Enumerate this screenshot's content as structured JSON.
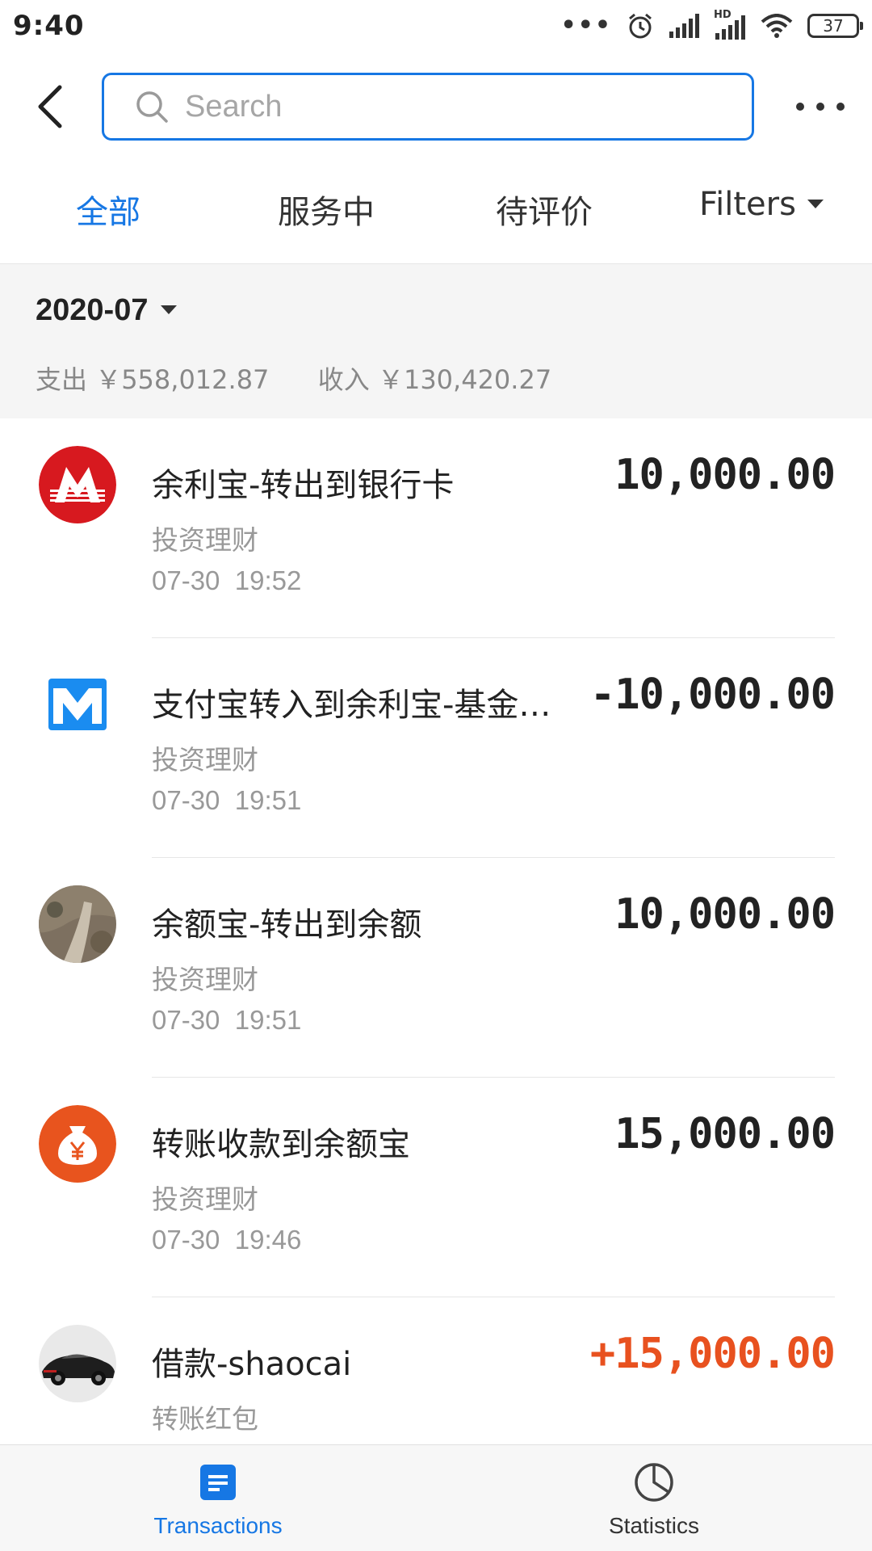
{
  "status_bar": {
    "time": "9:40",
    "battery": "37",
    "hd_label": "HD"
  },
  "search": {
    "placeholder": "Search"
  },
  "tabs": [
    {
      "label": "全部",
      "active": true
    },
    {
      "label": "服务中",
      "active": false
    },
    {
      "label": "待评价",
      "active": false
    },
    {
      "label": "Filters",
      "active": false
    }
  ],
  "month": {
    "selected": "2020-07",
    "expense_label": "支出",
    "expense_amount": "￥558,012.87",
    "income_label": "收入",
    "income_amount": "￥130,420.27"
  },
  "transactions": [
    {
      "title": "余利宝-转出到银行卡",
      "category": "投资理财",
      "time": "07-30  19:52",
      "amount": "10,000.00",
      "icon": "cmb-bank-logo-icon"
    },
    {
      "title": "支付宝转入到余利宝-基金…",
      "category": "投资理财",
      "time": "07-30  19:51",
      "amount": "-10,000.00",
      "icon": "mybank-logo-icon"
    },
    {
      "title": "余额宝-转出到余额",
      "category": "投资理财",
      "time": "07-30  19:51",
      "amount": "10,000.00",
      "icon": "landscape-photo-avatar"
    },
    {
      "title": "转账收款到余额宝",
      "category": "投资理财",
      "time": "07-30  19:46",
      "amount": "15,000.00",
      "icon": "money-bag-icon"
    },
    {
      "title": "借款-shaocai",
      "category": "转账红包",
      "time": "",
      "amount": "+15,000.00",
      "icon": "car-photo-avatar"
    }
  ],
  "bottom_nav": [
    {
      "label": "Transactions",
      "icon": "document-list-icon",
      "active": true
    },
    {
      "label": "Statistics",
      "icon": "pie-chart-icon",
      "active": false
    }
  ],
  "colors": {
    "accent": "#1677e4",
    "positive_amount": "#e8511f",
    "cmb_red": "#d7191f",
    "money_bag_orange": "#e8541e"
  }
}
